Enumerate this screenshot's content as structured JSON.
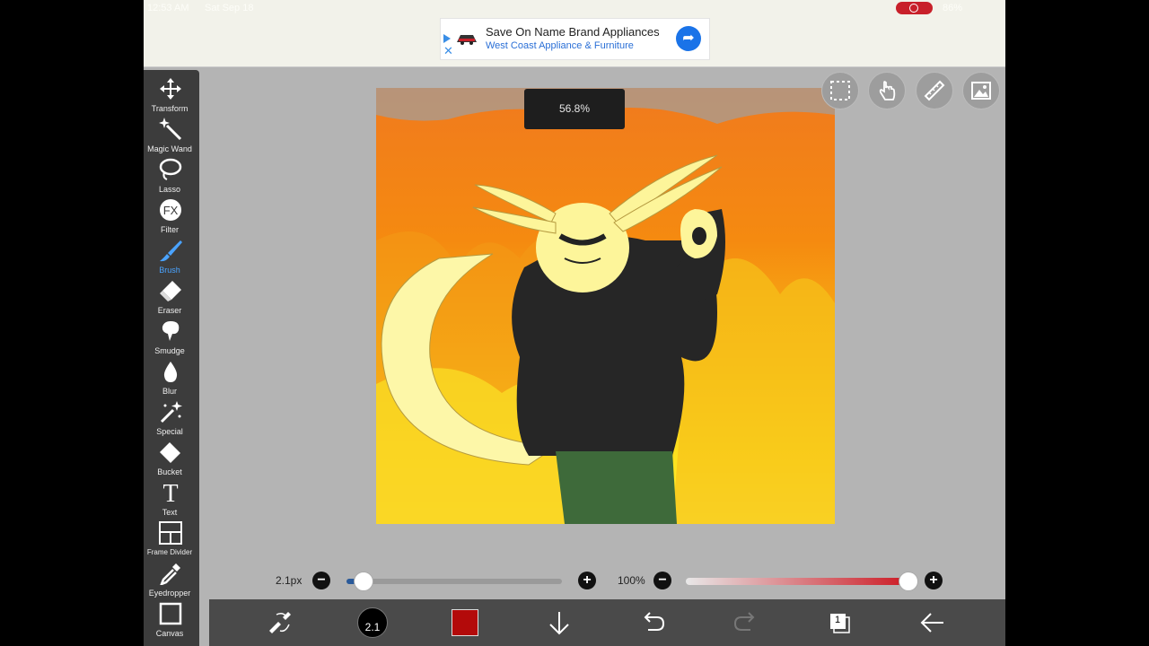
{
  "status": {
    "time": "12:53 AM",
    "date": "Sat Sep 18",
    "battery": "86%"
  },
  "ad": {
    "headline": "Save On Name Brand Appliances",
    "advertiser": "West Coast Appliance & Furniture",
    "play_icon": "play-triangle-icon",
    "close_icon": "close-icon",
    "cta_icon": "directions-arrow-icon"
  },
  "tools": [
    {
      "label": "Transform",
      "icon": "move-arrows-icon"
    },
    {
      "label": "Magic Wand",
      "icon": "magic-wand-icon"
    },
    {
      "label": "Lasso",
      "icon": "lasso-icon"
    },
    {
      "label": "Filter",
      "icon": "fx-icon"
    },
    {
      "label": "Brush",
      "icon": "brush-icon",
      "active": true
    },
    {
      "label": "Eraser",
      "icon": "eraser-icon"
    },
    {
      "label": "Smudge",
      "icon": "smudge-icon"
    },
    {
      "label": "Blur",
      "icon": "drop-icon"
    },
    {
      "label": "Special",
      "icon": "sparkle-wand-icon"
    },
    {
      "label": "Bucket",
      "icon": "bucket-icon"
    },
    {
      "label": "Text",
      "icon": "text-t-icon"
    },
    {
      "label": "Frame Divider",
      "icon": "frame-divider-icon"
    },
    {
      "label": "Eyedropper",
      "icon": "eyedropper-icon"
    },
    {
      "label": "Canvas",
      "icon": "canvas-square-icon"
    }
  ],
  "zoom_readout": "56.8%",
  "brush": {
    "size_label": "2.1px",
    "size_fraction": 0.08,
    "thumb_label": "2.1"
  },
  "opacity": {
    "label": "100%",
    "fraction": 1.0
  },
  "colors": {
    "primary": "#b30a0a",
    "accent": "#4aa3ff"
  },
  "layer_count": "1"
}
